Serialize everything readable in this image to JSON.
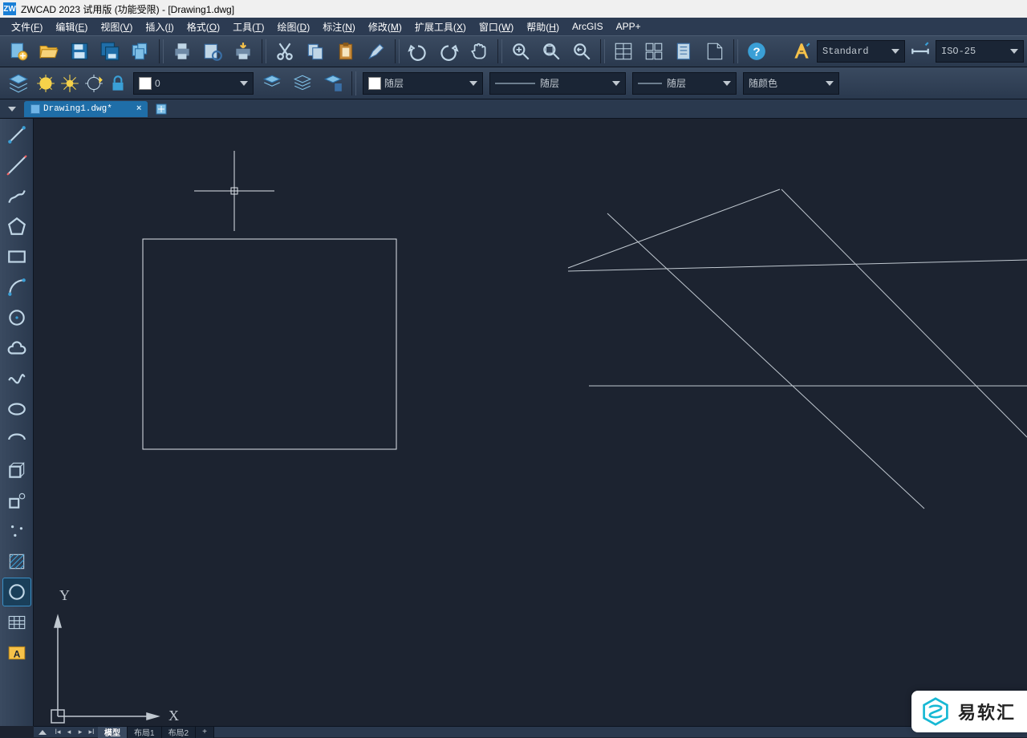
{
  "title": {
    "text": "ZWCAD 2023 试用版 (功能受限) - [Drawing1.dwg]",
    "app_icon_label": "ZW"
  },
  "menu": {
    "items": [
      {
        "label": "文件",
        "accel": "F"
      },
      {
        "label": "编辑",
        "accel": "E"
      },
      {
        "label": "视图",
        "accel": "V"
      },
      {
        "label": "插入",
        "accel": "I"
      },
      {
        "label": "格式",
        "accel": "O"
      },
      {
        "label": "工具",
        "accel": "T"
      },
      {
        "label": "绘图",
        "accel": "D"
      },
      {
        "label": "标注",
        "accel": "N"
      },
      {
        "label": "修改",
        "accel": "M"
      },
      {
        "label": "扩展工具",
        "accel": "X"
      },
      {
        "label": "窗口",
        "accel": "W"
      },
      {
        "label": "帮助",
        "accel": "H"
      },
      {
        "label": "ArcGIS",
        "accel": ""
      },
      {
        "label": "APP+",
        "accel": ""
      }
    ]
  },
  "toolbar1": {
    "text_style_value": "Standard",
    "dim_style_value": "ISO-25"
  },
  "toolbar2": {
    "layer_value": "0",
    "linetype_value": "随层",
    "lineweight_value": "随层",
    "plotstyle_value": "随层",
    "color_value": "随颜色"
  },
  "tabs": {
    "file_tab_label": "Drawing1.dwg*"
  },
  "canvas": {
    "axis_x_label": "X",
    "axis_y_label": "Y"
  },
  "layout_tabs": {
    "model": "模型",
    "layout1": "布局1",
    "layout2": "布局2",
    "plus": "+"
  },
  "watermark": {
    "text": "易软汇"
  }
}
